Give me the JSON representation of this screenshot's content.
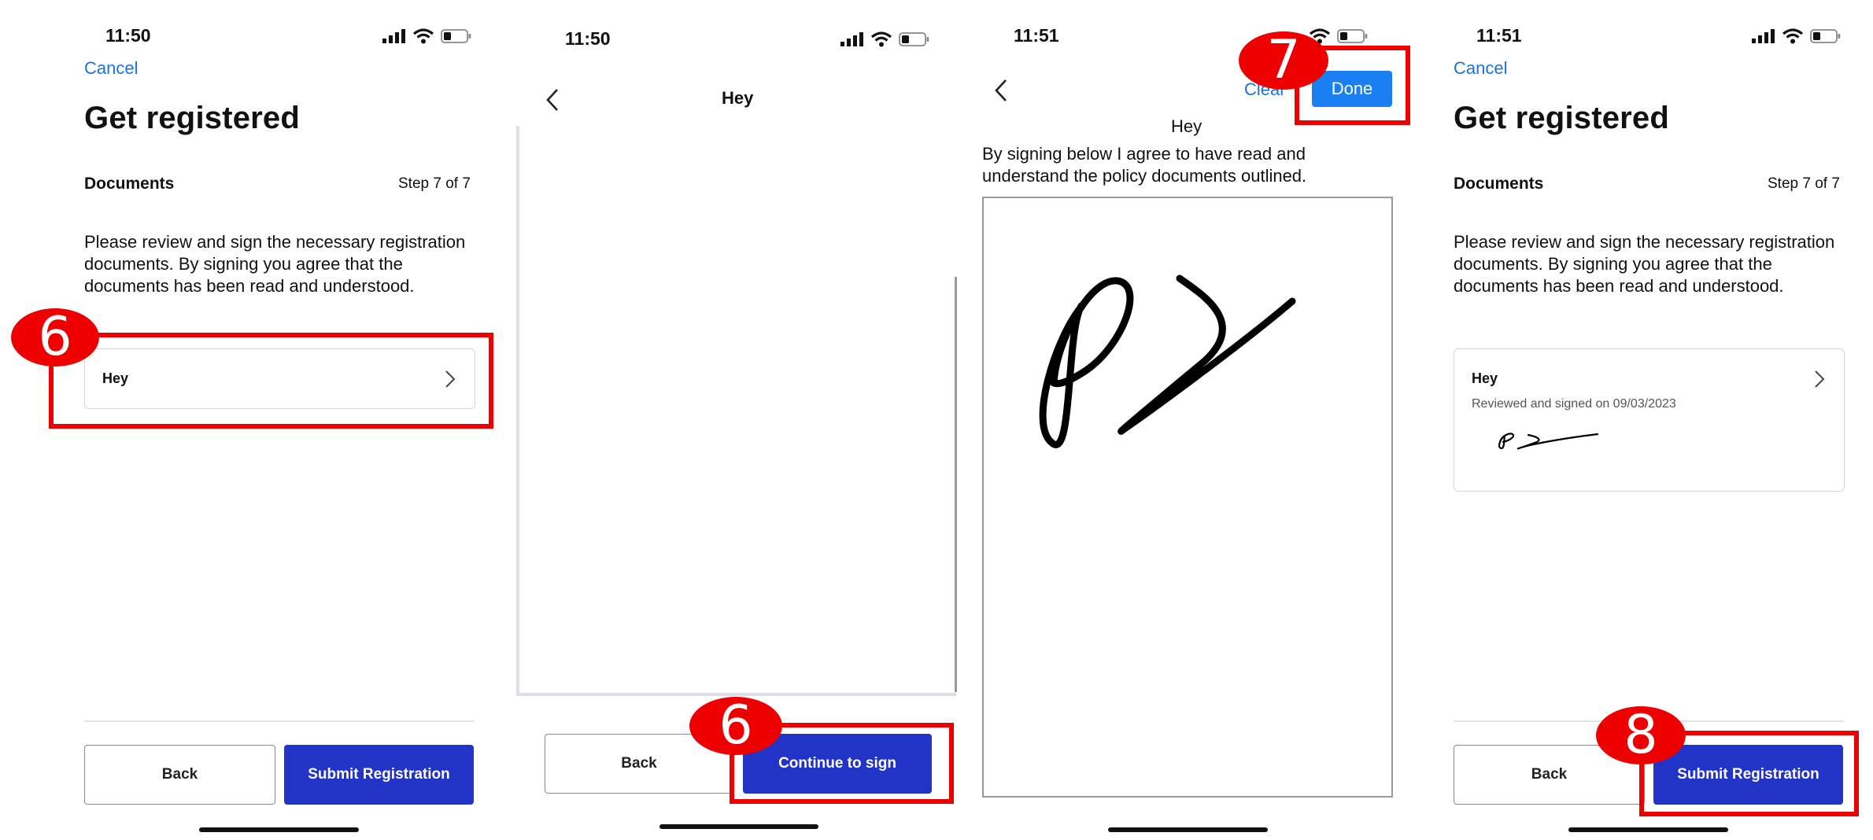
{
  "screen1": {
    "time": "11:50",
    "cancel": "Cancel",
    "title": "Get registered",
    "section": "Documents",
    "step": "Step 7 of 7",
    "description": "Please review and sign the necessary registration documents. By signing you agree that the documents has been read and understood.",
    "document_name": "Hey",
    "back_label": "Back",
    "submit_label": "Submit Registration",
    "annotation": "6"
  },
  "screen2": {
    "time": "11:50",
    "title": "Hey",
    "back_label": "Back",
    "continue_label": "Continue to sign",
    "annotation": "6"
  },
  "screen3": {
    "time": "11:51",
    "clear_label": "Clear",
    "done_label": "Done",
    "title": "Hey",
    "agreement": "By signing below I agree to have read and understand the policy documents outlined.",
    "annotation": "7"
  },
  "screen4": {
    "time": "11:51",
    "cancel": "Cancel",
    "title": "Get registered",
    "section": "Documents",
    "step": "Step 7 of 7",
    "description": "Please review and sign the necessary registration documents. By signing you agree that the documents has been read and understood.",
    "document_name": "Hey",
    "signed_note": "Reviewed and signed on 09/03/2023",
    "back_label": "Back",
    "submit_label": "Submit Registration",
    "annotation": "8"
  },
  "colors": {
    "accent_link": "#1a73d9",
    "primary_button": "#2233c8",
    "done_button": "#1a7ff0",
    "annotation_red": "#ee0000"
  }
}
